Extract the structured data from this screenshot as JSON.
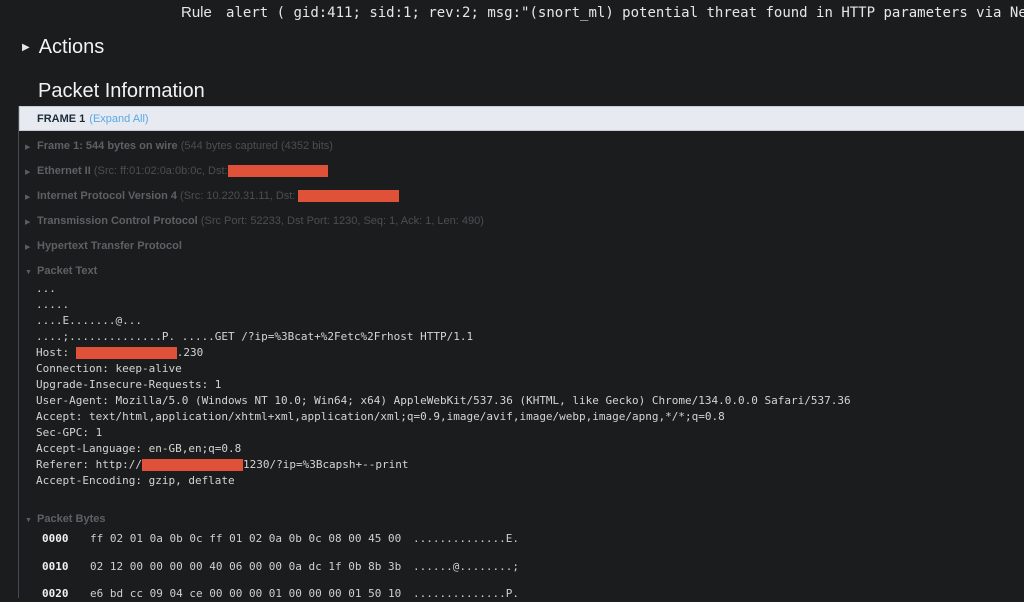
{
  "rule": {
    "label": "Rule",
    "text": "alert ( gid:411; sid:1; rev:2; msg:\"(snort_ml) potential threat found in HTTP parameters via Ne"
  },
  "actions": {
    "label": "Actions"
  },
  "packet_information": {
    "title": "Packet Information"
  },
  "frame": {
    "title": "FRAME 1",
    "expand_label": "(Expand All)"
  },
  "tree": {
    "frame_info": {
      "bold": "Frame 1: 544 bytes on wire",
      "light": "(544 bytes captured (4352 bits)"
    },
    "ethernet": {
      "bold": "Ethernet II",
      "light": "(Src: ff:01:02:0a:0b:0c, Dst:"
    },
    "ipv4": {
      "bold": "Internet Protocol Version 4",
      "light": "(Src: 10.220.31.11, Dst:"
    },
    "tcp": {
      "bold": "Transmission Control Protocol",
      "light": "(Src Port: 52233, Dst Port: 1230, Seq: 1, Ack: 1, Len: 490)"
    },
    "http": {
      "bold": "Hypertext Transfer Protocol"
    },
    "packet_text": {
      "bold": "Packet Text"
    },
    "packet_bytes": {
      "bold": "Packet Bytes"
    }
  },
  "packet_text_lines": {
    "l1": "...",
    "l2": ".....",
    "l3": "....E.......@...",
    "l4": "....;..............P. .....GET /?ip=%3Bcat+%2Fetc%2Frhost HTTP/1.1",
    "l5_pre": "Host: ",
    "l5_post": ".230",
    "l6": "Connection: keep-alive",
    "l7": "Upgrade-Insecure-Requests: 1",
    "l8": "User-Agent: Mozilla/5.0 (Windows NT 10.0; Win64; x64) AppleWebKit/537.36 (KHTML, like Gecko) Chrome/134.0.0.0 Safari/537.36",
    "l9": "Accept: text/html,application/xhtml+xml,application/xml;q=0.9,image/avif,image/webp,image/apng,*/*;q=0.8",
    "l10": "Sec-GPC: 1",
    "l11": "Accept-Language: en-GB,en;q=0.8",
    "l12_pre": "Referer: http://",
    "l12_post": "1230/?ip=%3Bcapsh+--print",
    "l13": "Accept-Encoding: gzip, deflate"
  },
  "packet_bytes": [
    {
      "offset": "0000",
      "hex": "ff 02 01 0a 0b 0c ff 01 02 0a 0b 0c 08 00 45 00",
      "ascii": "..............E."
    },
    {
      "offset": "0010",
      "hex": "02 12 00 00 00 00 40 06 00 00 0a dc 1f 0b 8b 3b",
      "ascii": "......@........;"
    },
    {
      "offset": "0020",
      "hex": "e6 bd cc 09 04 ce 00 00 00 01 00 00 00 01 50 10",
      "ascii": "..............P."
    }
  ],
  "colors": {
    "redaction": "#e0513a",
    "link": "#5aa7e6",
    "header_bg": "#e7ebf1",
    "background": "#1b1c1e"
  }
}
